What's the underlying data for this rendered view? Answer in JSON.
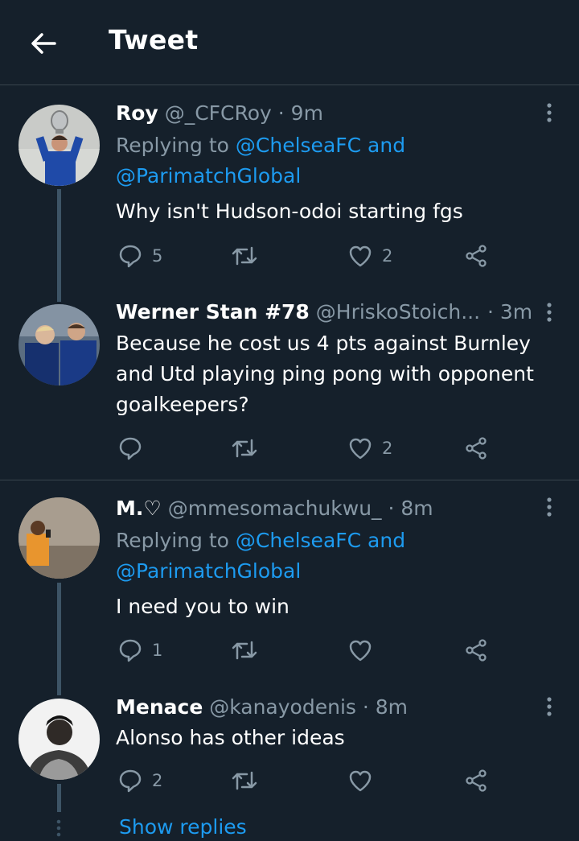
{
  "header": {
    "title": "Tweet"
  },
  "tweets": [
    {
      "name": "Roy",
      "handle": "@_CFCRoy",
      "time": "· 9m",
      "replying": "Replying to",
      "reply_to_1": "@ChelseaFC and",
      "reply_to_2": "@ParimatchGlobal",
      "text": "Why isn't Hudson-odoi starting fgs",
      "replies": "5",
      "likes": "2"
    },
    {
      "name": "Werner Stan #78",
      "handle": "@HriskoStoich...",
      "time": "· 3m",
      "text_lines": [
        "Because he cost us 4 pts against Burnley",
        "and Utd playing ping pong with opponent",
        "goalkeepers?"
      ],
      "replies": "",
      "likes": "2"
    },
    {
      "name": "M.♡",
      "handle": "@mmesomachukwu_",
      "time": "· 8m",
      "replying": "Replying to",
      "reply_to_1": "@ChelseaFC and",
      "reply_to_2": "@ParimatchGlobal",
      "text": "I need you to win",
      "replies": "1",
      "likes": ""
    },
    {
      "name": "Menace",
      "handle": "@kanayodenis",
      "time": "· 8m",
      "text": "Alonso has other ideas",
      "replies": "2",
      "likes": ""
    }
  ],
  "show_replies": "Show replies",
  "colors": {
    "background": "#15202b",
    "link": "#1d9bf0",
    "muted": "#8899a6",
    "divider": "#38444d"
  },
  "icons": [
    "back-arrow-icon",
    "more-vertical-icon",
    "reply-icon",
    "retweet-icon",
    "like-icon",
    "share-icon"
  ]
}
